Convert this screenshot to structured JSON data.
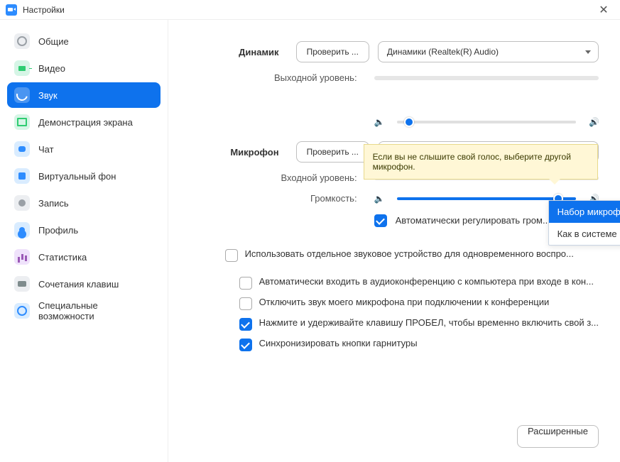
{
  "window": {
    "title": "Настройки"
  },
  "sidebar": {
    "items": [
      {
        "label": "Общие"
      },
      {
        "label": "Видео"
      },
      {
        "label": "Звук"
      },
      {
        "label": "Демонстрация экрана"
      },
      {
        "label": "Чат"
      },
      {
        "label": "Виртуальный фон"
      },
      {
        "label": "Запись"
      },
      {
        "label": "Профиль"
      },
      {
        "label": "Статистика"
      },
      {
        "label": "Сочетания клавиш"
      },
      {
        "label": "Специальные возможности"
      }
    ]
  },
  "speaker": {
    "label": "Динамик",
    "test_button": "Проверить ...",
    "device": "Динамики (Realtek(R) Audio)",
    "output_level_label": "Выходной уровень:"
  },
  "mic": {
    "label": "Микрофон",
    "test_button": "Проверить ...",
    "device": "Набор микрофонов (Realtek(R) ...",
    "input_level_label": "Входной уровень:",
    "volume_label": "Громкость:",
    "options": [
      "Набор микрофонов (Realtek(R) Audio)",
      "Как в системе"
    ],
    "auto_adjust": "Автоматически регулировать гром..."
  },
  "tooltip": "Если вы не слышите свой голос, выберите другой микрофон.",
  "checkboxes": {
    "separate_device": "Использовать отдельное звуковое устройство для одновременного воспро...",
    "auto_join_audio": "Автоматически входить в аудиоконференцию с компьютера при входе в кон...",
    "mute_on_join": "Отключить звук моего микрофона при подключении к конференции",
    "push_to_talk": "Нажмите и удерживайте клавишу ПРОБЕЛ, чтобы временно включить свой з...",
    "sync_headset": "Синхронизировать кнопки гарнитуры"
  },
  "advanced_button": "Расширенные"
}
